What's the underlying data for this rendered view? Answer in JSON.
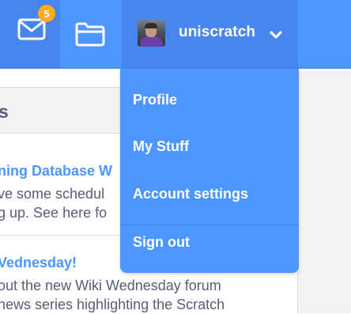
{
  "nav": {
    "messages": {
      "icon": "envelope-icon",
      "badge_count": "5",
      "badge_color": "#FFAB1A"
    },
    "my_stuff": {
      "icon": "folder-icon"
    },
    "account": {
      "username": "uniscratch",
      "avatar": "avatar-icon",
      "chevron": "chevron-down-icon"
    },
    "bar_color": "#4C97FF",
    "active_color": "#4686EE"
  },
  "dropdown": {
    "items": [
      {
        "label": "Profile"
      },
      {
        "label": "My Stuff"
      },
      {
        "label": "Account settings"
      },
      {
        "label": "Sign out"
      }
    ]
  },
  "page": {
    "panel_header": "s",
    "news": [
      {
        "title": "ning Database W",
        "body": [
          "ve some schedul",
          "g up. See here fo"
        ]
      },
      {
        "title": "Vednesday!",
        "body": [
          "out the new Wiki Wednesday forum",
          "news series highlighting the Scratch"
        ]
      }
    ]
  }
}
